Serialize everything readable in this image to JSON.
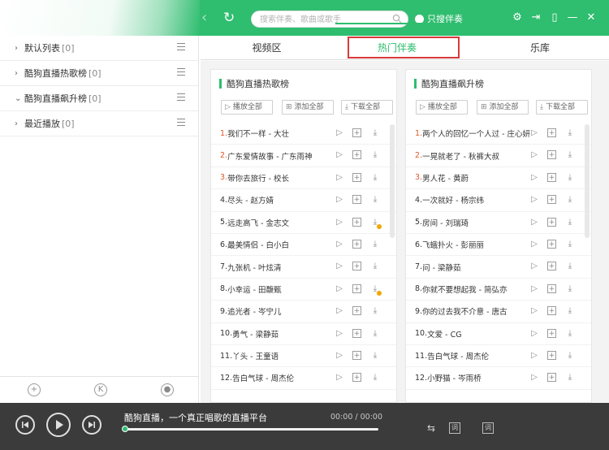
{
  "search": {
    "placeholder": "搜索伴奏、歌曲或歌手"
  },
  "only_accompaniment_label": "只搜伴奏",
  "sidebar": {
    "items": [
      {
        "label": "默认列表",
        "count": "[0]",
        "expanded": false
      },
      {
        "label": "酷狗直播热歌榜",
        "count": "[0]",
        "expanded": false
      },
      {
        "label": "酷狗直播飙升榜",
        "count": "[0]",
        "expanded": true
      },
      {
        "label": "最近播放",
        "count": "[0]",
        "expanded": false
      }
    ]
  },
  "tabs": [
    {
      "label": "视频区"
    },
    {
      "label": "热门伴奏"
    },
    {
      "label": "乐库"
    }
  ],
  "active_tab": "热门伴奏",
  "panels": [
    {
      "title": "酷狗直播热歌榜",
      "actions": {
        "play_all": "播放全部",
        "add_all": "添加全部",
        "download_all": "下载全部"
      },
      "songs": [
        {
          "num": "1.",
          "title": "我们不一样 - 大壮",
          "badge": false
        },
        {
          "num": "2.",
          "title": "广东爱情故事 - 广东雨神",
          "badge": false
        },
        {
          "num": "3.",
          "title": "带你去旅行 - 校长",
          "badge": false
        },
        {
          "num": "4.",
          "title": "尽头 - 赵方婧",
          "badge": false
        },
        {
          "num": "5.",
          "title": "远走高飞 - 金志文",
          "badge": true
        },
        {
          "num": "6.",
          "title": "最美情侣 - 白小白",
          "badge": false
        },
        {
          "num": "7.",
          "title": "九张机 - 叶炫清",
          "badge": false
        },
        {
          "num": "8.",
          "title": "小幸运 - 田馥甄",
          "badge": true
        },
        {
          "num": "9.",
          "title": "追光者 - 岑宁儿",
          "badge": false
        },
        {
          "num": "10.",
          "title": "勇气 - 梁静茹",
          "badge": false
        },
        {
          "num": "11.",
          "title": "丫头 - 王童语",
          "badge": false
        },
        {
          "num": "12.",
          "title": "告白气球 - 周杰伦",
          "badge": false
        }
      ]
    },
    {
      "title": "酷狗直播飙升榜",
      "actions": {
        "play_all": "播放全部",
        "add_all": "添加全部",
        "download_all": "下载全部"
      },
      "songs": [
        {
          "num": "1.",
          "title": "两个人的回忆一个人过 - 庄心妍",
          "badge": false
        },
        {
          "num": "2.",
          "title": "一晃就老了 - 秋裤大叔",
          "badge": false
        },
        {
          "num": "3.",
          "title": "男人花 - 黄蔚",
          "badge": false
        },
        {
          "num": "4.",
          "title": "一次就好 - 杨宗纬",
          "badge": false
        },
        {
          "num": "5.",
          "title": "房间 - 刘瑞琦",
          "badge": false
        },
        {
          "num": "6.",
          "title": "飞蛾扑火 - 彭丽丽",
          "badge": false
        },
        {
          "num": "7.",
          "title": "问 - 梁静茹",
          "badge": false
        },
        {
          "num": "8.",
          "title": "你就不要想起我 - 简弘亦",
          "badge": false
        },
        {
          "num": "9.",
          "title": "你的过去我不介意 - 唐古",
          "badge": false
        },
        {
          "num": "10.",
          "title": "文爱 - CG",
          "badge": false
        },
        {
          "num": "11.",
          "title": "告白气球 - 周杰伦",
          "badge": false
        },
        {
          "num": "12.",
          "title": "小野猫 - 岑雨桥",
          "badge": false
        }
      ]
    }
  ],
  "player": {
    "title": "酷狗直播，一个真正唱歌的直播平台",
    "time": "00:00 / 00:00",
    "progress": 0
  },
  "colors": {
    "accent": "#2fbd6f",
    "highlight_border": "#d93a3a",
    "top_rank": "#e0582a",
    "player_bg": "#3b3b3b"
  },
  "icons": {
    "nav": [
      "back-arrow-icon",
      "refresh-icon"
    ],
    "window": [
      "gear-icon",
      "login-icon",
      "mobile-icon",
      "minimize-icon",
      "close-icon"
    ],
    "song_ops": [
      "play-icon",
      "add-icon",
      "download-icon"
    ],
    "sidebar_footer": [
      "add-playlist-icon",
      "kugou-icon",
      "search-icon"
    ],
    "player": [
      "prev-icon",
      "play-icon",
      "next-icon",
      "repeat-icon",
      "lyrics-icon",
      "desktop-lyrics-icon"
    ]
  }
}
